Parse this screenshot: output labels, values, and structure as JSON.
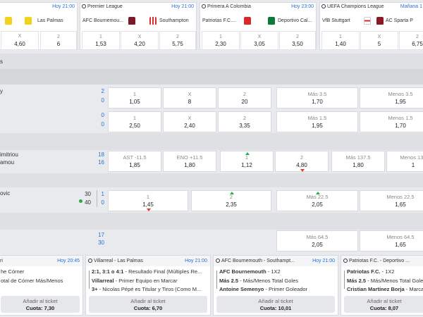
{
  "top_cards": [
    {
      "league": "",
      "time": "Hoy 21:00",
      "home": "",
      "away": "Las Palmas",
      "odds": [
        {
          "l": "",
          "v": "4,60"
        },
        {
          "l": "X",
          "v": "4,60"
        },
        {
          "l": "2",
          "v": "6"
        }
      ]
    },
    {
      "league": "Premier League",
      "time": "Hoy 21:00",
      "home": "AFC Bournemou...",
      "away": "Southampton",
      "odds": [
        {
          "l": "1",
          "v": "1,53"
        },
        {
          "l": "X",
          "v": "4,20"
        },
        {
          "l": "2",
          "v": "5,75"
        }
      ]
    },
    {
      "league": "Primera A Colombia",
      "time": "Hoy 23:00",
      "home": "Patriotas F.C....",
      "away": "Deportivo Cal...",
      "odds": [
        {
          "l": "1",
          "v": "2,30"
        },
        {
          "l": "X",
          "v": "3,05"
        },
        {
          "l": "2",
          "v": "3,50"
        }
      ]
    },
    {
      "league": "UEFA Champions League",
      "time": "Mañana 1",
      "home": "VfB Stuttgart",
      "away": "AC Sparta P",
      "odds": [
        {
          "l": "1",
          "v": "1,40"
        },
        {
          "l": "X",
          "v": "5"
        },
        {
          "l": "2",
          "v": "6,75"
        }
      ]
    }
  ],
  "section_label": "s",
  "rows": [
    {
      "name": "y",
      "s1": "2",
      "s2": "0",
      "odds": [
        {
          "l": "1",
          "v": "1,05"
        },
        {
          "l": "X",
          "v": "8"
        },
        {
          "l": "2",
          "v": "20"
        },
        {
          "l": "Más 3.5",
          "v": "1,70"
        },
        {
          "l": "Menos 3.5",
          "v": "1,95"
        }
      ]
    },
    {
      "name": "",
      "s1": "0",
      "s2": "0",
      "odds": [
        {
          "l": "1",
          "v": "2,50"
        },
        {
          "l": "X",
          "v": "2,40"
        },
        {
          "l": "2",
          "v": "3,35"
        },
        {
          "l": "Más 1.5",
          "v": "1,95"
        },
        {
          "l": "Menos 1.5",
          "v": "1,70"
        }
      ]
    },
    {
      "name1": "imitriou",
      "name2": "amou",
      "s1": "18",
      "s2": "16",
      "odds": [
        {
          "l": "AST -11.5",
          "v": "1,85"
        },
        {
          "l": "ENO +11.5",
          "v": "1,80"
        },
        {
          "l": "1",
          "v": "1,12"
        },
        {
          "l": "2",
          "v": "4,80"
        },
        {
          "l": "Más 137.5",
          "v": "1,80"
        },
        {
          "l": "Menos 137",
          "v": "1"
        }
      ]
    },
    {
      "name": "ovic",
      "g1": "30",
      "g2": "40",
      "p1": "1",
      "p2": "0",
      "odds": [
        {
          "l": "1",
          "v": "1,45"
        },
        {
          "l": "2",
          "v": "2,35"
        },
        {
          "l": "Más 22.5",
          "v": "2,05"
        },
        {
          "l": "Menos 22.5",
          "v": "1,65"
        }
      ]
    },
    {
      "s1": "17",
      "s2": "30",
      "odds": [
        {
          "l": "Más 64.5",
          "v": "2,05"
        },
        {
          "l": "Menos 64.5",
          "v": "1,65"
        }
      ]
    }
  ],
  "bet_cards": [
    {
      "match": "ri",
      "time": "Hoy 20:45",
      "lines": [
        "he Córner",
        "otal de Córner Más/Menos"
      ],
      "add": "Añadir al ticket",
      "quota": "Cuota: 7,30"
    },
    {
      "match": "Villarreal - Las Palmas",
      "time": "Hoy 21:00",
      "lines": [
        [
          "2:1, 3:1 o 4:1",
          " - Resultado Final (Múltiples Re..."
        ],
        [
          "Villarreal",
          " - Primer Equipo en Marcar"
        ],
        [
          "3+",
          " - Nicolas Pépé es Titular y Tiros (Como M..."
        ]
      ],
      "add": "Añadir al ticket",
      "quota": "Cuota: 6,70"
    },
    {
      "match": "AFC Bournemouth - Southampt...",
      "time": "Hoy 21:00",
      "lines": [
        [
          "AFC Bournemouth",
          " - 1X2"
        ],
        [
          "Más 2.5",
          " - Más/Menos Total Goles"
        ],
        [
          "Antoine Semenyo",
          " - Primer Goleador"
        ]
      ],
      "add": "Añadir al ticket",
      "quota": "Cuota: 10,01"
    },
    {
      "match": "Patriotas F.C. - Deportivo ...",
      "time": "",
      "lines": [
        [
          "Patriotas F.C.",
          " - 1X2"
        ],
        [
          "Más 2.5",
          " - Más/Menos Total Goles"
        ],
        [
          "Cristian Martínez Borja",
          " - Marca"
        ]
      ],
      "add": "Añadir al ticket",
      "quota": "Cuota: 8,07"
    }
  ]
}
